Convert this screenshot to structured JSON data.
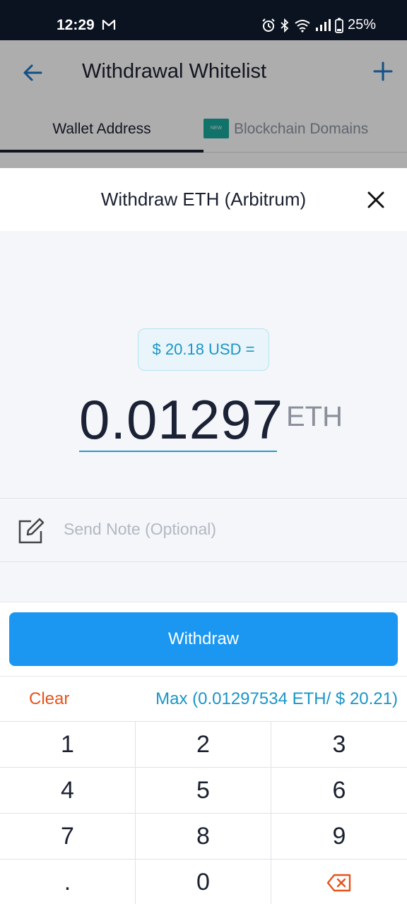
{
  "status": {
    "time": "12:29",
    "battery": "25%"
  },
  "header": {
    "title": "Withdrawal Whitelist"
  },
  "tabs": [
    {
      "label": "Wallet Address"
    },
    {
      "label": "Blockchain Domains",
      "badge": "NEW"
    }
  ],
  "sheet": {
    "title": "Withdraw ETH (Arbitrum)",
    "usd_value": "$ 20.18 USD =",
    "amount": "0.01297",
    "unit": "ETH",
    "note_placeholder": "Send Note (Optional)",
    "withdraw_label": "Withdraw",
    "clear_label": "Clear",
    "max_label": "Max (0.01297534 ETH/ $ 20.21)"
  },
  "keypad": {
    "keys": [
      "1",
      "2",
      "3",
      "4",
      "5",
      "6",
      "7",
      "8",
      "9",
      ".",
      "0"
    ]
  },
  "colors": {
    "accent": "#1b97f1",
    "link": "#1a95c8",
    "clear": "#e6531b",
    "new_badge": "#1aa89c"
  }
}
